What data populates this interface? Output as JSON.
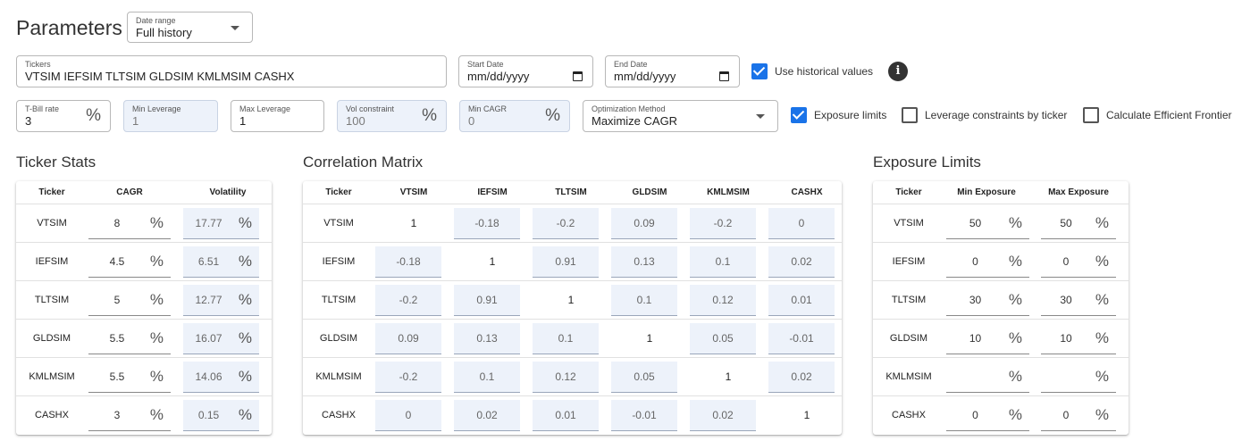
{
  "header": {
    "title": "Parameters",
    "date_range": {
      "label": "Date range",
      "value": "Full history"
    }
  },
  "inputs": {
    "tickers": {
      "label": "Tickers",
      "value": "VTSIM IEFSIM TLTSIM GLDSIM KMLMSIM CASHX"
    },
    "start_date": {
      "label": "Start Date",
      "value": "mm/dd/yyyy"
    },
    "end_date": {
      "label": "End Date",
      "value": "mm/dd/yyyy"
    },
    "use_historical": {
      "label": "Use historical values",
      "checked": true
    },
    "tbill_rate": {
      "label": "T-Bill rate",
      "value": "3",
      "unit": "%"
    },
    "min_leverage": {
      "label": "Min Leverage",
      "value": "1"
    },
    "max_leverage": {
      "label": "Max Leverage",
      "value": "1"
    },
    "vol_constraint": {
      "label": "Vol constraint",
      "value": "100",
      "unit": "%"
    },
    "min_cagr": {
      "label": "Min CAGR",
      "value": "0",
      "unit": "%"
    },
    "optimization_method": {
      "label": "Optimization Method",
      "value": "Maximize CAGR"
    },
    "exposure_limits": {
      "label": "Exposure limits",
      "checked": true
    },
    "leverage_by_ticker": {
      "label": "Leverage constraints by ticker",
      "checked": false
    },
    "efficient_frontier": {
      "label": "Calculate Efficient Frontier",
      "checked": false
    }
  },
  "ticker_stats": {
    "title": "Ticker Stats",
    "headers": [
      "Ticker",
      "CAGR",
      "Volatility"
    ],
    "unit": "%",
    "rows": [
      {
        "ticker": "VTSIM",
        "cagr": "8",
        "vol": "17.77"
      },
      {
        "ticker": "IEFSIM",
        "cagr": "4.5",
        "vol": "6.51"
      },
      {
        "ticker": "TLTSIM",
        "cagr": "5",
        "vol": "12.77"
      },
      {
        "ticker": "GLDSIM",
        "cagr": "5.5",
        "vol": "16.07"
      },
      {
        "ticker": "KMLMSIM",
        "cagr": "5.5",
        "vol": "14.06"
      },
      {
        "ticker": "CASHX",
        "cagr": "3",
        "vol": "0.15"
      }
    ]
  },
  "correlation": {
    "title": "Correlation Matrix",
    "headers": [
      "Ticker",
      "VTSIM",
      "IEFSIM",
      "TLTSIM",
      "GLDSIM",
      "KMLMSIM",
      "CASHX"
    ],
    "rows": [
      {
        "ticker": "VTSIM",
        "values": [
          "1",
          "-0.18",
          "-0.2",
          "0.09",
          "-0.2",
          "0"
        ]
      },
      {
        "ticker": "IEFSIM",
        "values": [
          "-0.18",
          "1",
          "0.91",
          "0.13",
          "0.1",
          "0.02"
        ]
      },
      {
        "ticker": "TLTSIM",
        "values": [
          "-0.2",
          "0.91",
          "1",
          "0.1",
          "0.12",
          "0.01"
        ]
      },
      {
        "ticker": "GLDSIM",
        "values": [
          "0.09",
          "0.13",
          "0.1",
          "1",
          "0.05",
          "-0.01"
        ]
      },
      {
        "ticker": "KMLMSIM",
        "values": [
          "-0.2",
          "0.1",
          "0.12",
          "0.05",
          "1",
          "0.02"
        ]
      },
      {
        "ticker": "CASHX",
        "values": [
          "0",
          "0.02",
          "0.01",
          "-0.01",
          "0.02",
          "1"
        ]
      }
    ]
  },
  "exposure": {
    "title": "Exposure Limits",
    "headers": [
      "Ticker",
      "Min Exposure",
      "Max Exposure"
    ],
    "unit": "%",
    "rows": [
      {
        "ticker": "VTSIM",
        "min": "50",
        "max": "50"
      },
      {
        "ticker": "IEFSIM",
        "min": "0",
        "max": "0"
      },
      {
        "ticker": "TLTSIM",
        "min": "30",
        "max": "30"
      },
      {
        "ticker": "GLDSIM",
        "min": "10",
        "max": "10"
      },
      {
        "ticker": "KMLMSIM",
        "min": "",
        "max": ""
      },
      {
        "ticker": "CASHX",
        "min": "0",
        "max": "0"
      }
    ]
  },
  "colors": {
    "accent": "#1a73e8",
    "filled_bg": "#edf2fa",
    "text": "#333333"
  }
}
